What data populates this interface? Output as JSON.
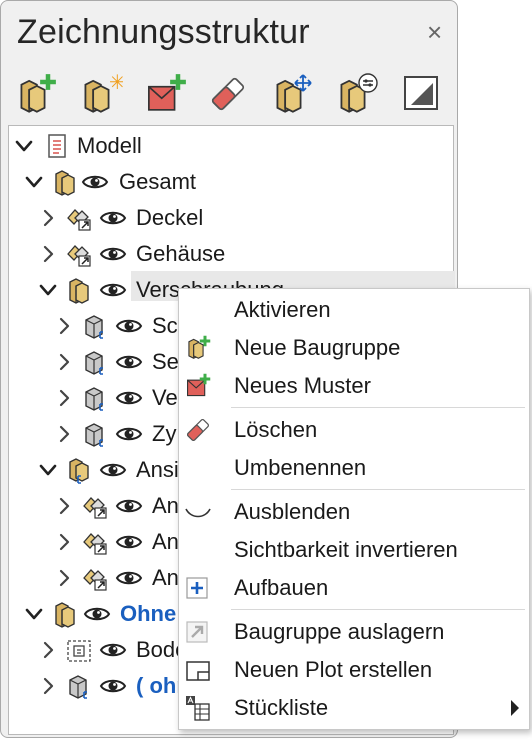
{
  "panel": {
    "title": "Zeichnungsstruktur",
    "close_glyph": "×"
  },
  "toolbar": {
    "buttons": [
      {
        "name": "new-group-icon"
      },
      {
        "name": "new-group-star-icon"
      },
      {
        "name": "new-pattern-icon"
      },
      {
        "name": "eraser-icon"
      },
      {
        "name": "move-group-icon"
      },
      {
        "name": "group-settings-icon"
      },
      {
        "name": "plot-icon"
      }
    ]
  },
  "tree": {
    "rows": [
      {
        "label": "Modell",
        "style": "normal"
      },
      {
        "label": "Gesamt",
        "style": "normal"
      },
      {
        "label": "Deckel",
        "style": "normal"
      },
      {
        "label": "Gehäuse",
        "style": "normal"
      },
      {
        "label": "Verschraubung",
        "style": "normal"
      },
      {
        "label": "Sch",
        "style": "normal"
      },
      {
        "label": "Sec",
        "style": "normal"
      },
      {
        "label": "Ve",
        "style": "normal"
      },
      {
        "label": "Zy",
        "style": "normal"
      },
      {
        "label": "Ansi",
        "style": "normal"
      },
      {
        "label": "An",
        "style": "normal"
      },
      {
        "label": "An",
        "style": "normal"
      },
      {
        "label": "An",
        "style": "normal"
      },
      {
        "label": "Ohne",
        "style": "blue"
      },
      {
        "label": "Bode",
        "style": "normal"
      },
      {
        "label": "( ohn",
        "style": "blue"
      }
    ]
  },
  "context_menu": {
    "items": [
      {
        "label": "Aktivieren",
        "icon": ""
      },
      {
        "label": "Neue Baugruppe",
        "icon": "new-group-icon"
      },
      {
        "label": "Neues Muster",
        "icon": "new-pattern-icon"
      },
      {
        "label": "Löschen",
        "icon": "eraser-icon"
      },
      {
        "label": "Umbenennen",
        "icon": ""
      },
      {
        "label": "Ausblenden",
        "icon": "hide-icon"
      },
      {
        "label": "Sichtbarkeit invertieren",
        "icon": ""
      },
      {
        "label": "Aufbauen",
        "icon": "plus-box-icon"
      },
      {
        "label": "Baugruppe auslagern",
        "icon": "export-arrow-icon"
      },
      {
        "label": "Neuen Plot erstellen",
        "icon": "plot-frame-icon"
      },
      {
        "label": "Stückliste",
        "icon": "parts-list-icon",
        "submenu": true
      }
    ]
  },
  "colors": {
    "accent_blue": "#1a5fbf",
    "group_tan": "#d9b462",
    "plus_green": "#3fae49",
    "eraser_red": "#e0605a"
  }
}
